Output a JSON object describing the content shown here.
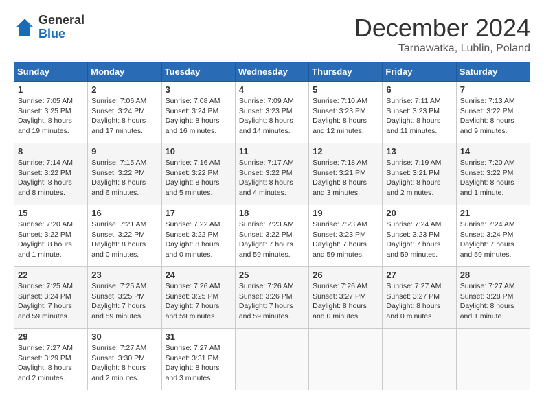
{
  "header": {
    "logo_general": "General",
    "logo_blue": "Blue",
    "month_title": "December 2024",
    "location": "Tarnawatka, Lublin, Poland"
  },
  "days_of_week": [
    "Sunday",
    "Monday",
    "Tuesday",
    "Wednesday",
    "Thursday",
    "Friday",
    "Saturday"
  ],
  "weeks": [
    [
      {
        "day": 1,
        "sunrise": "7:05 AM",
        "sunset": "3:25 PM",
        "daylight": "8 hours and 19 minutes"
      },
      {
        "day": 2,
        "sunrise": "7:06 AM",
        "sunset": "3:24 PM",
        "daylight": "8 hours and 17 minutes"
      },
      {
        "day": 3,
        "sunrise": "7:08 AM",
        "sunset": "3:24 PM",
        "daylight": "8 hours and 16 minutes"
      },
      {
        "day": 4,
        "sunrise": "7:09 AM",
        "sunset": "3:23 PM",
        "daylight": "8 hours and 14 minutes"
      },
      {
        "day": 5,
        "sunrise": "7:10 AM",
        "sunset": "3:23 PM",
        "daylight": "8 hours and 12 minutes"
      },
      {
        "day": 6,
        "sunrise": "7:11 AM",
        "sunset": "3:23 PM",
        "daylight": "8 hours and 11 minutes"
      },
      {
        "day": 7,
        "sunrise": "7:13 AM",
        "sunset": "3:22 PM",
        "daylight": "8 hours and 9 minutes"
      }
    ],
    [
      {
        "day": 8,
        "sunrise": "7:14 AM",
        "sunset": "3:22 PM",
        "daylight": "8 hours and 8 minutes"
      },
      {
        "day": 9,
        "sunrise": "7:15 AM",
        "sunset": "3:22 PM",
        "daylight": "8 hours and 6 minutes"
      },
      {
        "day": 10,
        "sunrise": "7:16 AM",
        "sunset": "3:22 PM",
        "daylight": "8 hours and 5 minutes"
      },
      {
        "day": 11,
        "sunrise": "7:17 AM",
        "sunset": "3:22 PM",
        "daylight": "8 hours and 4 minutes"
      },
      {
        "day": 12,
        "sunrise": "7:18 AM",
        "sunset": "3:21 PM",
        "daylight": "8 hours and 3 minutes"
      },
      {
        "day": 13,
        "sunrise": "7:19 AM",
        "sunset": "3:21 PM",
        "daylight": "8 hours and 2 minutes"
      },
      {
        "day": 14,
        "sunrise": "7:20 AM",
        "sunset": "3:22 PM",
        "daylight": "8 hours and 1 minute"
      }
    ],
    [
      {
        "day": 15,
        "sunrise": "7:20 AM",
        "sunset": "3:22 PM",
        "daylight": "8 hours and 1 minute"
      },
      {
        "day": 16,
        "sunrise": "7:21 AM",
        "sunset": "3:22 PM",
        "daylight": "8 hours and 0 minutes"
      },
      {
        "day": 17,
        "sunrise": "7:22 AM",
        "sunset": "3:22 PM",
        "daylight": "8 hours and 0 minutes"
      },
      {
        "day": 18,
        "sunrise": "7:23 AM",
        "sunset": "3:22 PM",
        "daylight": "7 hours and 59 minutes"
      },
      {
        "day": 19,
        "sunrise": "7:23 AM",
        "sunset": "3:23 PM",
        "daylight": "7 hours and 59 minutes"
      },
      {
        "day": 20,
        "sunrise": "7:24 AM",
        "sunset": "3:23 PM",
        "daylight": "7 hours and 59 minutes"
      },
      {
        "day": 21,
        "sunrise": "7:24 AM",
        "sunset": "3:24 PM",
        "daylight": "7 hours and 59 minutes"
      }
    ],
    [
      {
        "day": 22,
        "sunrise": "7:25 AM",
        "sunset": "3:24 PM",
        "daylight": "7 hours and 59 minutes"
      },
      {
        "day": 23,
        "sunrise": "7:25 AM",
        "sunset": "3:25 PM",
        "daylight": "7 hours and 59 minutes"
      },
      {
        "day": 24,
        "sunrise": "7:26 AM",
        "sunset": "3:25 PM",
        "daylight": "7 hours and 59 minutes"
      },
      {
        "day": 25,
        "sunrise": "7:26 AM",
        "sunset": "3:26 PM",
        "daylight": "7 hours and 59 minutes"
      },
      {
        "day": 26,
        "sunrise": "7:26 AM",
        "sunset": "3:27 PM",
        "daylight": "8 hours and 0 minutes"
      },
      {
        "day": 27,
        "sunrise": "7:27 AM",
        "sunset": "3:27 PM",
        "daylight": "8 hours and 0 minutes"
      },
      {
        "day": 28,
        "sunrise": "7:27 AM",
        "sunset": "3:28 PM",
        "daylight": "8 hours and 1 minute"
      }
    ],
    [
      {
        "day": 29,
        "sunrise": "7:27 AM",
        "sunset": "3:29 PM",
        "daylight": "8 hours and 2 minutes"
      },
      {
        "day": 30,
        "sunrise": "7:27 AM",
        "sunset": "3:30 PM",
        "daylight": "8 hours and 2 minutes"
      },
      {
        "day": 31,
        "sunrise": "7:27 AM",
        "sunset": "3:31 PM",
        "daylight": "8 hours and 3 minutes"
      },
      null,
      null,
      null,
      null
    ]
  ]
}
